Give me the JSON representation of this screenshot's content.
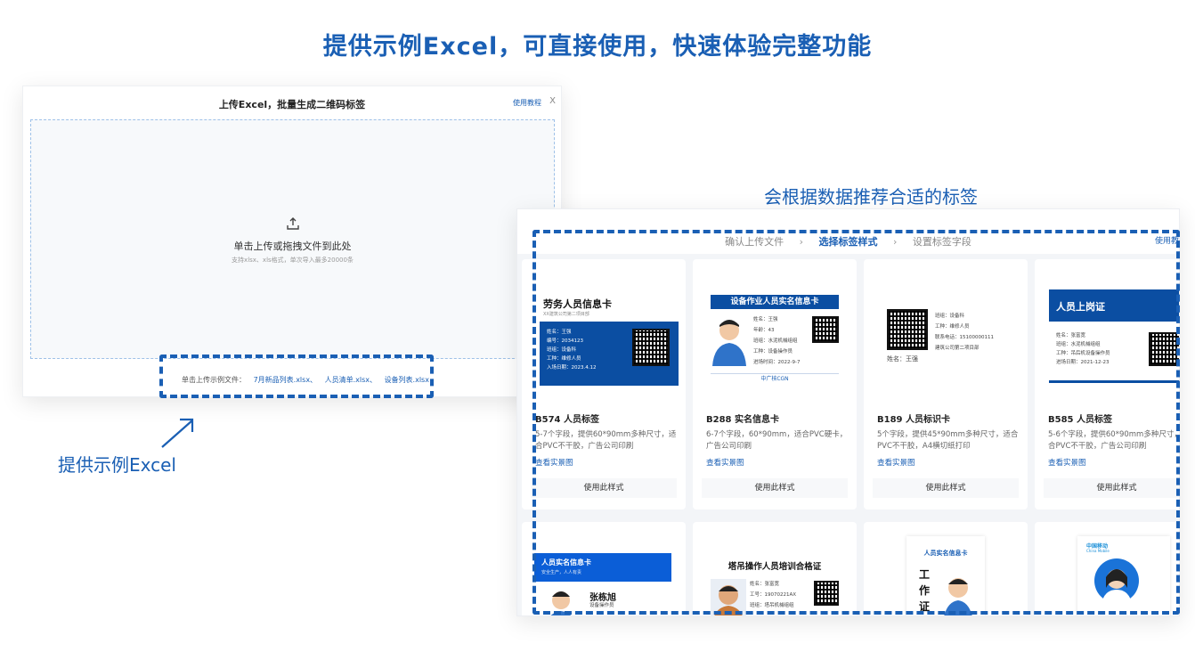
{
  "headline": "提供示例Excel，可直接使用，快速体验完整功能",
  "upload": {
    "title": "上传Excel，批量生成二维码标签",
    "help": "使用教程",
    "close": "X",
    "drop_main": "单击上传或拖拽文件到此处",
    "drop_sub": "支持xlsx、xls格式，单次导入最多20000条",
    "samples_label": "单击上传示例文件：",
    "sample_files": [
      "7月新品列表.xlsx、",
      "人员清单.xlsx、",
      "设备列表.xlsx"
    ]
  },
  "captions": {
    "excel": "提供示例Excel",
    "recommend": "会根据数据推荐合适的标签"
  },
  "steps": {
    "step1": "确认上传文件",
    "step2": "选择标签样式",
    "step3": "设置标签字段",
    "chevron": "›",
    "help": "使用教"
  },
  "cards": [
    {
      "name": "B574 人员标签",
      "desc": "5-7个字段，提供60*90mm多种尺寸，适合PVC不干胶，广告公司印刷",
      "link": "查看实景图",
      "use": "使用此样式",
      "preview": {
        "title": "劳务人员信息卡",
        "subtitle": "XX建筑公司第二项目部",
        "fields": [
          "姓名：王强",
          "编号：2034123",
          "班组：设备科",
          "工种：维修人员",
          "入场日期：2023.4.12"
        ]
      }
    },
    {
      "name": "B288 实名信息卡",
      "desc": "6-7个字段，60*90mm，适合PVC硬卡，广告公司印刷",
      "link": "查看实景图",
      "use": "使用此样式",
      "preview": {
        "title": "设备作业人员实名信息卡",
        "fields": [
          "姓名：王强",
          "年龄：43",
          "班组：水泥机械组组",
          "工种：设备操作员",
          "进场时间：2022-9-7"
        ],
        "logo": "中广核CGN"
      }
    },
    {
      "name": "B189 人员标识卡",
      "desc": "5个字段，提供45*90mm多种尺寸，适合PVC不干胶，A4横切纸打印",
      "link": "查看实景图",
      "use": "使用此样式",
      "preview": {
        "fields": [
          "班组：设备科",
          "工种：维修人员",
          "联系电话：15100000111",
          "建筑公司第二项目部"
        ],
        "caption": "姓名：王强"
      }
    },
    {
      "name": "B585 人员标签",
      "desc": "5-6个字段，提供60*90mm多种尺寸，适合PVC不干胶，广告公司印刷",
      "link": "查看实景图",
      "use": "使用此样式",
      "preview": {
        "title": "人员上岗证",
        "fields": [
          "姓名：张富宽",
          "班组：水泥机械组组",
          "工种：吊后机设备操作员",
          "进场日期：2021-12-23"
        ]
      }
    }
  ],
  "small_cards": [
    {
      "title": "人员实名信息卡",
      "subtitle": "安全生产，人人有责",
      "name": "张栋旭",
      "role": "设备操作员"
    },
    {
      "title": "塔吊操作人员培训合格证",
      "fields": [
        "姓名：张富宽",
        "工号：19070221AX",
        "班组：塔吊机械组组"
      ]
    },
    {
      "title": "人员实名信息卡",
      "vertical": [
        "工",
        "作",
        "证"
      ]
    },
    {
      "brand": "中国移动",
      "brand_en": "China Mobile"
    }
  ],
  "colors": {
    "accent": "#1a5fb4",
    "navy": "#0b4ea2"
  }
}
